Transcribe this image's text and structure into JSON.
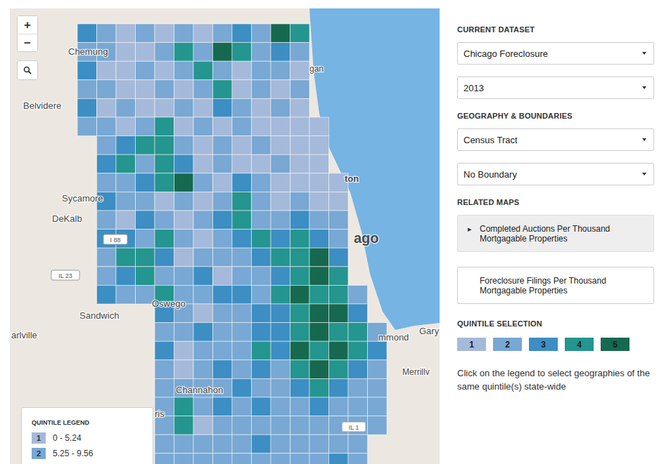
{
  "map": {
    "zoom_in": "+",
    "zoom_out": "−",
    "labels": [
      {
        "text": "Chemung"
      },
      {
        "text": "Belvidere"
      },
      {
        "text": "Sycamore"
      },
      {
        "text": "DeKalb"
      },
      {
        "text": "Oswego"
      },
      {
        "text": "Sandwich"
      },
      {
        "text": "arlville"
      },
      {
        "text": "Channahon"
      },
      {
        "text": "ris"
      },
      {
        "text": "Gary"
      },
      {
        "text": "mmond"
      },
      {
        "text": "Merrillv"
      },
      {
        "text": "ton"
      },
      {
        "text": "ago"
      },
      {
        "text": "gan"
      }
    ],
    "shields": [
      {
        "text": "I 88"
      },
      {
        "text": "IL 23"
      },
      {
        "text": "IL 1"
      }
    ],
    "tract_quintiles": [
      [
        3,
        2,
        1,
        2,
        1,
        2,
        1,
        2,
        3,
        2,
        5,
        4,
        0,
        0,
        0,
        0
      ],
      [
        2,
        2,
        1,
        1,
        2,
        4,
        2,
        5,
        4,
        2,
        3,
        2,
        0,
        0,
        0,
        0
      ],
      [
        3,
        1,
        1,
        2,
        1,
        2,
        4,
        2,
        1,
        2,
        2,
        1,
        0,
        0,
        0,
        0
      ],
      [
        2,
        2,
        1,
        1,
        2,
        1,
        2,
        4,
        1,
        2,
        1,
        2,
        0,
        0,
        0,
        0
      ],
      [
        3,
        1,
        2,
        1,
        1,
        2,
        1,
        3,
        2,
        1,
        2,
        1,
        0,
        0,
        0,
        0
      ],
      [
        2,
        2,
        1,
        2,
        4,
        1,
        2,
        1,
        2,
        1,
        1,
        1,
        1,
        0,
        0,
        0
      ],
      [
        0,
        2,
        3,
        4,
        4,
        2,
        1,
        2,
        1,
        2,
        1,
        1,
        1,
        0,
        0,
        0
      ],
      [
        0,
        3,
        4,
        2,
        4,
        3,
        1,
        2,
        1,
        1,
        2,
        1,
        1,
        0,
        0,
        0
      ],
      [
        0,
        2,
        2,
        3,
        4,
        5,
        2,
        1,
        3,
        2,
        1,
        1,
        1,
        1,
        0,
        0
      ],
      [
        0,
        3,
        2,
        2,
        1,
        2,
        1,
        2,
        4,
        2,
        1,
        2,
        1,
        1,
        0,
        0
      ],
      [
        0,
        2,
        1,
        3,
        2,
        1,
        2,
        3,
        4,
        2,
        2,
        3,
        2,
        2,
        0,
        0
      ],
      [
        0,
        3,
        3,
        2,
        4,
        2,
        1,
        2,
        3,
        4,
        3,
        4,
        3,
        2,
        0,
        0
      ],
      [
        0,
        2,
        4,
        4,
        3,
        1,
        2,
        2,
        2,
        3,
        4,
        4,
        5,
        3,
        0,
        0
      ],
      [
        0,
        2,
        3,
        4,
        2,
        2,
        3,
        1,
        2,
        2,
        3,
        4,
        5,
        4,
        0,
        0
      ],
      [
        0,
        3,
        2,
        2,
        4,
        2,
        2,
        3,
        3,
        2,
        4,
        5,
        4,
        4,
        2,
        0
      ],
      [
        0,
        0,
        0,
        0,
        3,
        2,
        1,
        2,
        2,
        3,
        3,
        4,
        5,
        5,
        3,
        0
      ],
      [
        0,
        0,
        0,
        0,
        2,
        2,
        3,
        2,
        2,
        3,
        3,
        4,
        5,
        4,
        4,
        2
      ],
      [
        0,
        0,
        0,
        0,
        3,
        1,
        2,
        2,
        2,
        4,
        3,
        5,
        4,
        5,
        4,
        3
      ],
      [
        0,
        0,
        0,
        0,
        2,
        1,
        2,
        3,
        2,
        3,
        2,
        4,
        5,
        4,
        3,
        2
      ],
      [
        0,
        0,
        0,
        0,
        2,
        2,
        2,
        2,
        3,
        2,
        2,
        3,
        4,
        3,
        2,
        2
      ],
      [
        0,
        0,
        0,
        0,
        2,
        4,
        2,
        3,
        2,
        3,
        2,
        2,
        3,
        2,
        2,
        2
      ],
      [
        0,
        0,
        0,
        0,
        2,
        4,
        1,
        2,
        2,
        2,
        2,
        2,
        2,
        2,
        2,
        2
      ],
      [
        0,
        0,
        0,
        0,
        2,
        2,
        2,
        2,
        2,
        3,
        2,
        2,
        2,
        2,
        2,
        0
      ],
      [
        0,
        0,
        0,
        0,
        2,
        2,
        2,
        2,
        2,
        2,
        2,
        2,
        2,
        3,
        2,
        0
      ]
    ]
  },
  "legend": {
    "title": "QUINTILE LEGEND",
    "items": [
      {
        "quintile": "1",
        "range": "0 - 5.24",
        "color": "#a5b9da"
      },
      {
        "quintile": "2",
        "range": "5.25 - 9.56",
        "color": "#78a8d3"
      }
    ]
  },
  "panel": {
    "dataset_title": "CURRENT DATASET",
    "dataset": {
      "value": "Chicago Foreclosure"
    },
    "year": {
      "value": "2013"
    },
    "geography_title": "GEOGRAPHY & BOUNDARIES",
    "geography": {
      "value": "Census Tract"
    },
    "boundary": {
      "value": "No Boundary"
    },
    "related_title": "RELATED MAPS",
    "related_marker": "▸",
    "related_maps": [
      {
        "text": "Completed Auctions Per Thousand Mortgagable Properties",
        "selected": true
      },
      {
        "text": "Foreclosure Filings Per Thousand Mortgagable Properties",
        "selected": false
      }
    ],
    "quintile_title": "QUINTILE SELECTION",
    "quintiles": [
      {
        "label": "1",
        "color": "#a5b9da"
      },
      {
        "label": "2",
        "color": "#78a8d3"
      },
      {
        "label": "3",
        "color": "#3c8ec3"
      },
      {
        "label": "4",
        "color": "#24958f"
      },
      {
        "label": "5",
        "color": "#16694f"
      }
    ],
    "hint": "Click on the legend to select geographies of the same quintile(s) state-wide"
  }
}
